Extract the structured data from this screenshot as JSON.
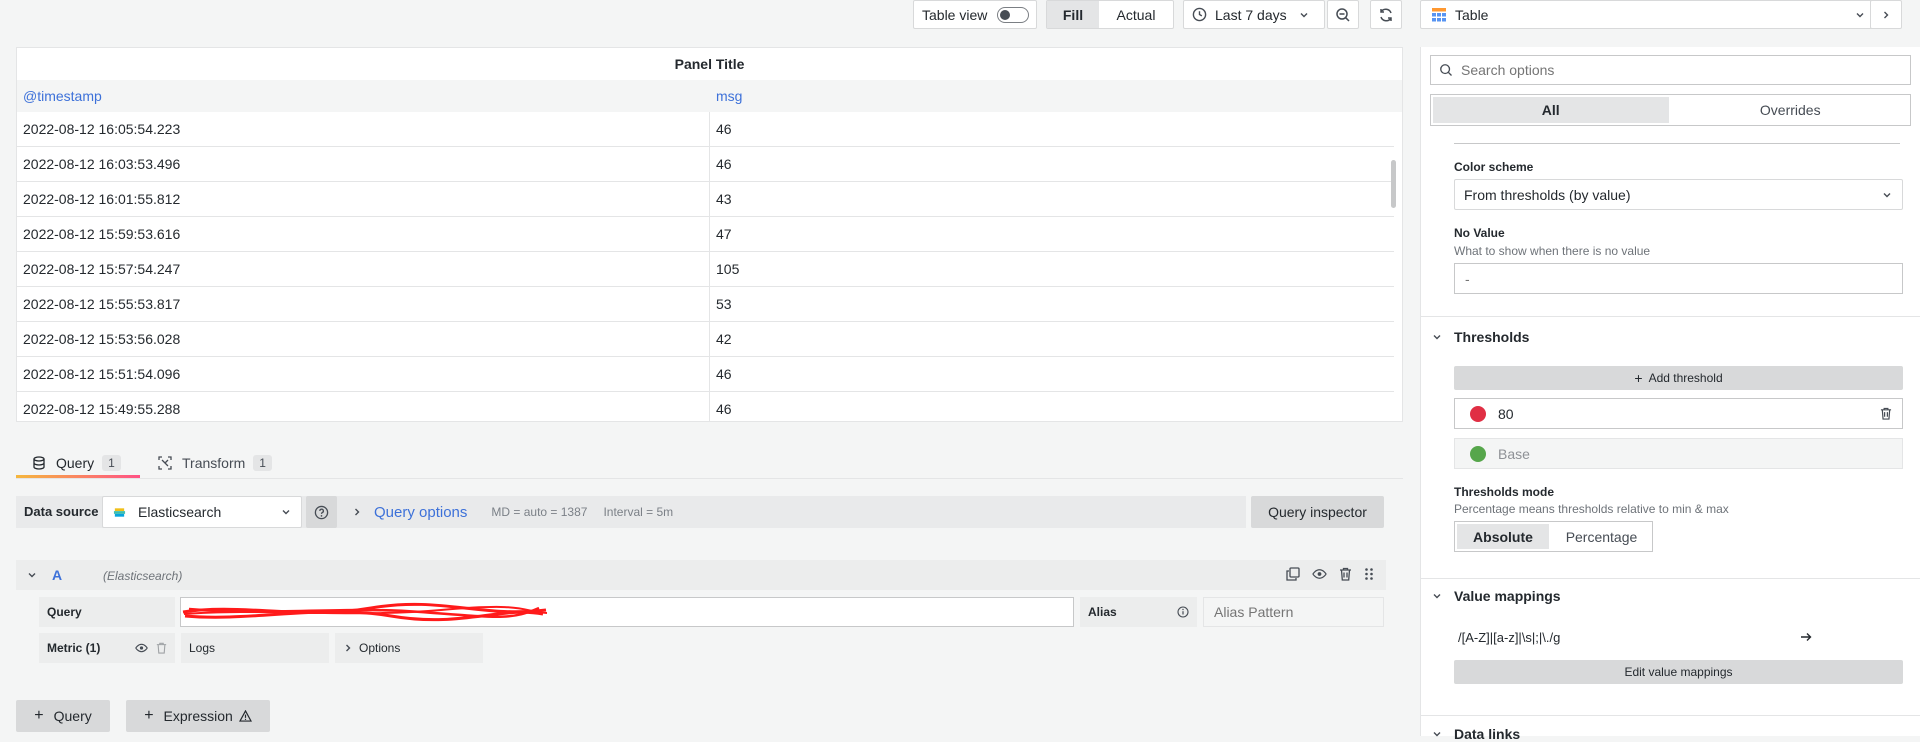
{
  "toolbar": {
    "table_view_label": "Table view",
    "fill_label": "Fill",
    "actual_label": "Actual",
    "time_range": "Last 7 days",
    "viz_name": "Table"
  },
  "panel": {
    "title": "Panel Title",
    "columns": [
      "@timestamp",
      "msg"
    ],
    "rows": [
      [
        "2022-08-12 16:05:54.223",
        "46"
      ],
      [
        "2022-08-12 16:03:53.496",
        "46"
      ],
      [
        "2022-08-12 16:01:55.812",
        "43"
      ],
      [
        "2022-08-12 15:59:53.616",
        "47"
      ],
      [
        "2022-08-12 15:57:54.247",
        "105"
      ],
      [
        "2022-08-12 15:55:53.817",
        "53"
      ],
      [
        "2022-08-12 15:53:56.028",
        "42"
      ],
      [
        "2022-08-12 15:51:54.096",
        "46"
      ],
      [
        "2022-08-12 15:49:55.288",
        "46"
      ]
    ]
  },
  "tabs": [
    {
      "label": "Query",
      "count": "1"
    },
    {
      "label": "Transform",
      "count": "1"
    }
  ],
  "query": {
    "data_source_label": "Data source",
    "data_source": "Elasticsearch",
    "query_options_label": "Query options",
    "md_info": "MD = auto = 1387",
    "interval_info": "Interval = 5m",
    "inspector_label": "Query inspector",
    "ref_id": "A",
    "ref_source": "(Elasticsearch)",
    "query_label": "Query",
    "alias_label": "Alias",
    "alias_placeholder": "Alias Pattern",
    "metric_label": "Metric (1)",
    "metric_value": "Logs",
    "options_label": "Options",
    "add_query_label": "Query",
    "add_expression_label": "Expression"
  },
  "options": {
    "search_placeholder": "Search options",
    "tab_all": "All",
    "tab_overrides": "Overrides",
    "color_scheme_label": "Color scheme",
    "color_scheme_value": "From thresholds (by value)",
    "no_value_label": "No Value",
    "no_value_desc": "What to show when there is no value",
    "no_value_placeholder": "-",
    "thresholds_title": "Thresholds",
    "add_threshold_label": "Add threshold",
    "threshold_value": "80",
    "threshold_base": "Base",
    "threshold_red": "#e02f44",
    "threshold_green": "#56a64b",
    "thresholds_mode_label": "Thresholds mode",
    "thresholds_mode_desc": "Percentage means thresholds relative to min & max",
    "mode_absolute": "Absolute",
    "mode_percentage": "Percentage",
    "value_mappings_title": "Value mappings",
    "mapping_regex": "/[A-Z]|[a-z]|\\s|;|\\./g",
    "edit_mappings_label": "Edit value mappings",
    "data_links_title": "Data links"
  }
}
